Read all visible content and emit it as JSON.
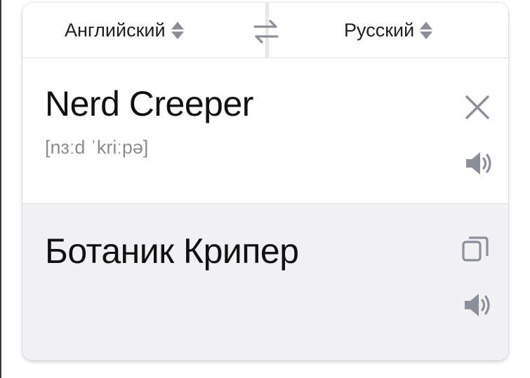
{
  "header": {
    "source_language": "Английский",
    "target_language": "Русский",
    "swap_icon": "swap-arrows-icon",
    "sort_icon": "sort-arrows-icon"
  },
  "source": {
    "text": "Nerd Creeper",
    "transcription": "[nɜːd ˈkriːpə]",
    "clear_icon": "close-icon",
    "speak_icon": "speaker-icon"
  },
  "translation": {
    "text": "Ботаник Крипер",
    "copy_icon": "copy-icon",
    "speak_icon": "speaker-icon"
  },
  "colors": {
    "icon_gray": "#8b8f99",
    "target_background": "#f1f1f3",
    "transcription_gray": "#8c8c8c"
  }
}
